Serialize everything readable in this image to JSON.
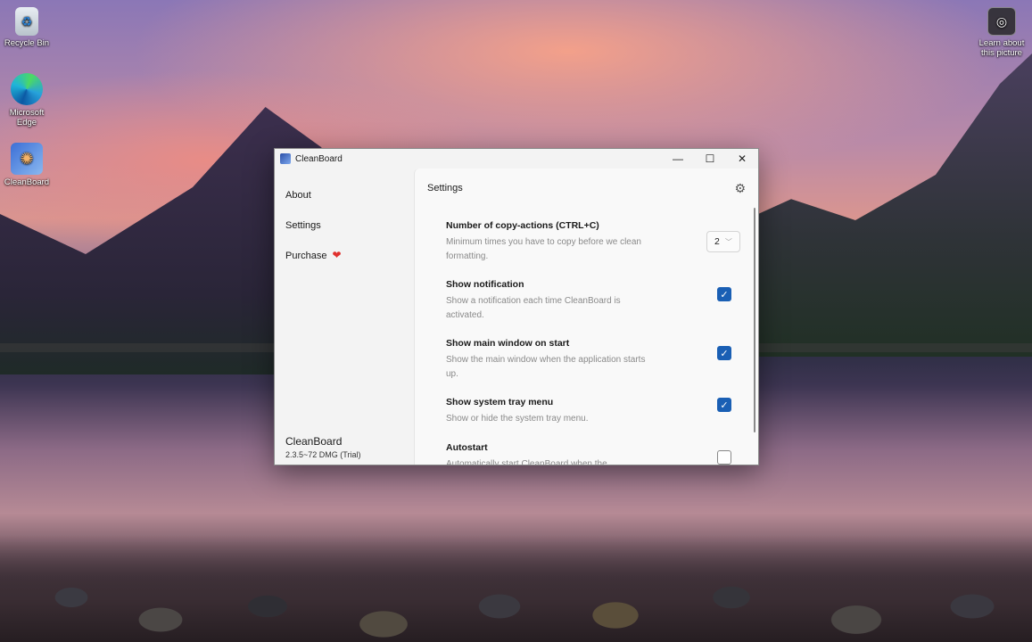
{
  "desktop": {
    "icons": [
      {
        "label": "Recycle Bin",
        "icon": "recycle-bin-icon"
      },
      {
        "label": "Microsoft Edge",
        "icon": "edge-icon"
      },
      {
        "label": "CleanBoard",
        "icon": "cleanboard-icon"
      }
    ],
    "learn_about": "Learn about this picture"
  },
  "window": {
    "title": "CleanBoard",
    "controls": {
      "minimize": "—",
      "maximize": "☐",
      "close": "✕"
    }
  },
  "sidebar": {
    "items": [
      {
        "label": "About"
      },
      {
        "label": "Settings"
      },
      {
        "label": "Purchase"
      }
    ],
    "heart": "❤",
    "footer_name": "CleanBoard",
    "footer_version": "2.3.5~72 DMG (Trial)"
  },
  "main": {
    "title": "Settings",
    "settings": [
      {
        "title": "Number of copy-actions (CTRL+C)",
        "desc": "Minimum times you have to copy before we clean formatting.",
        "control": "dropdown",
        "value": "2"
      },
      {
        "title": "Show notification",
        "desc": "Show a notification each time CleanBoard is activated.",
        "control": "checkbox",
        "checked": true
      },
      {
        "title": "Show main window on start",
        "desc": "Show the main window when the application starts up.",
        "control": "checkbox",
        "checked": true
      },
      {
        "title": "Show system tray menu",
        "desc": "Show or hide the system tray menu.",
        "control": "checkbox",
        "checked": true
      },
      {
        "title": "Autostart",
        "desc": "Automatically start CleanBoard when the",
        "control": "checkbox",
        "checked": false
      }
    ]
  },
  "colors": {
    "accent": "#1a5fb4",
    "heart": "#e0302e"
  }
}
